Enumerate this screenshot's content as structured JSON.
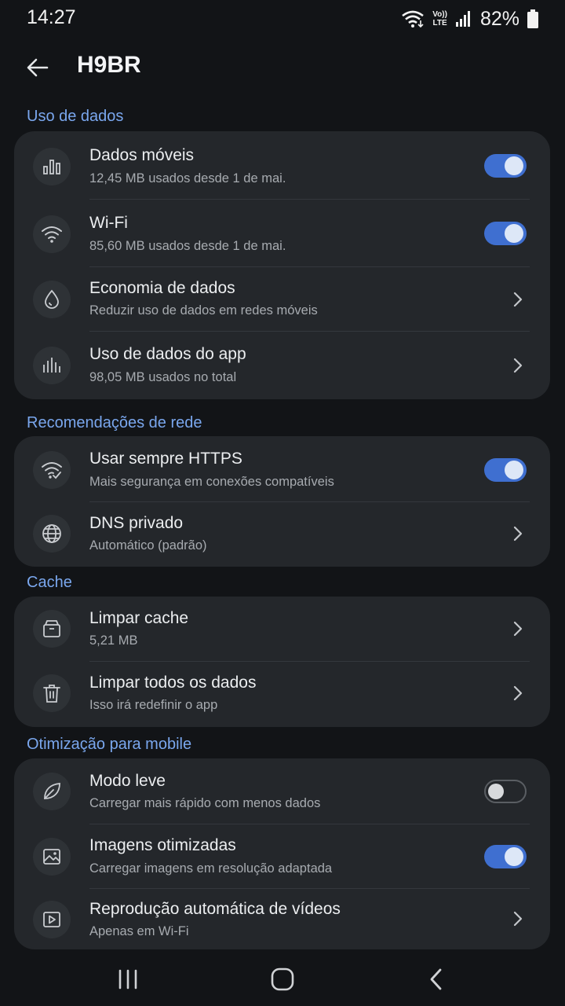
{
  "status_bar": {
    "time": "14:27",
    "network_top": "Vo))",
    "network_bottom": "LTE",
    "battery": "82%"
  },
  "app_bar": {
    "title": "H9BR",
    "back_icon": "arrow-left-icon"
  },
  "sections": {
    "data_usage": {
      "label": "Uso de dados",
      "items": [
        {
          "title": "Dados móveis",
          "subtitle": "12,45 MB usados desde 1 de mai.",
          "icon": "bar-chart-icon",
          "control": "toggle",
          "enabled": true
        },
        {
          "title": "Wi-Fi",
          "subtitle": "85,60 MB usados desde 1 de mai.",
          "icon": "wifi-icon",
          "control": "toggle",
          "enabled": true
        },
        {
          "title": "Economia de dados",
          "subtitle": "Reduzir uso de dados em redes móveis",
          "icon": "droplet-icon",
          "control": "chevron"
        },
        {
          "title": "Uso de dados do app",
          "subtitle": "98,05 MB usados no total",
          "icon": "app-usage-chart-icon",
          "control": "chevron"
        }
      ]
    },
    "network": {
      "label": "Recomendações de rede",
      "items": [
        {
          "title": "Usar sempre HTTPS",
          "subtitle": "Mais segurança em conexões compatíveis",
          "icon": "wifi-check-icon",
          "control": "toggle",
          "enabled": true
        },
        {
          "title": "DNS privado",
          "subtitle": "Automático (padrão)",
          "icon": "globe-icon",
          "control": "chevron"
        }
      ]
    },
    "cache": {
      "label": "Cache",
      "items": [
        {
          "title": "Limpar cache",
          "subtitle": "5,21 MB",
          "icon": "archive-icon",
          "control": "chevron"
        },
        {
          "title": "Limpar todos os dados",
          "subtitle": "Isso irá redefinir o app",
          "icon": "trash-icon",
          "control": "chevron"
        }
      ]
    },
    "mobile": {
      "label": "Otimização para mobile",
      "items": [
        {
          "title": "Modo leve",
          "subtitle": "Carregar mais rápido com menos dados",
          "icon": "leaf-icon",
          "control": "toggle",
          "enabled": false
        },
        {
          "title": "Imagens otimizadas",
          "subtitle": "Carregar imagens em resolução adaptada",
          "icon": "image-icon",
          "control": "toggle",
          "enabled": true
        },
        {
          "title": "Reprodução automática de vídeos",
          "subtitle": "Apenas em Wi-Fi",
          "icon": "video-play-icon",
          "control": "chevron"
        }
      ]
    }
  },
  "colors": {
    "background": "#121417",
    "card": "#24272b",
    "accent": "#3f6fd0",
    "section_label": "#7aa7ee"
  }
}
